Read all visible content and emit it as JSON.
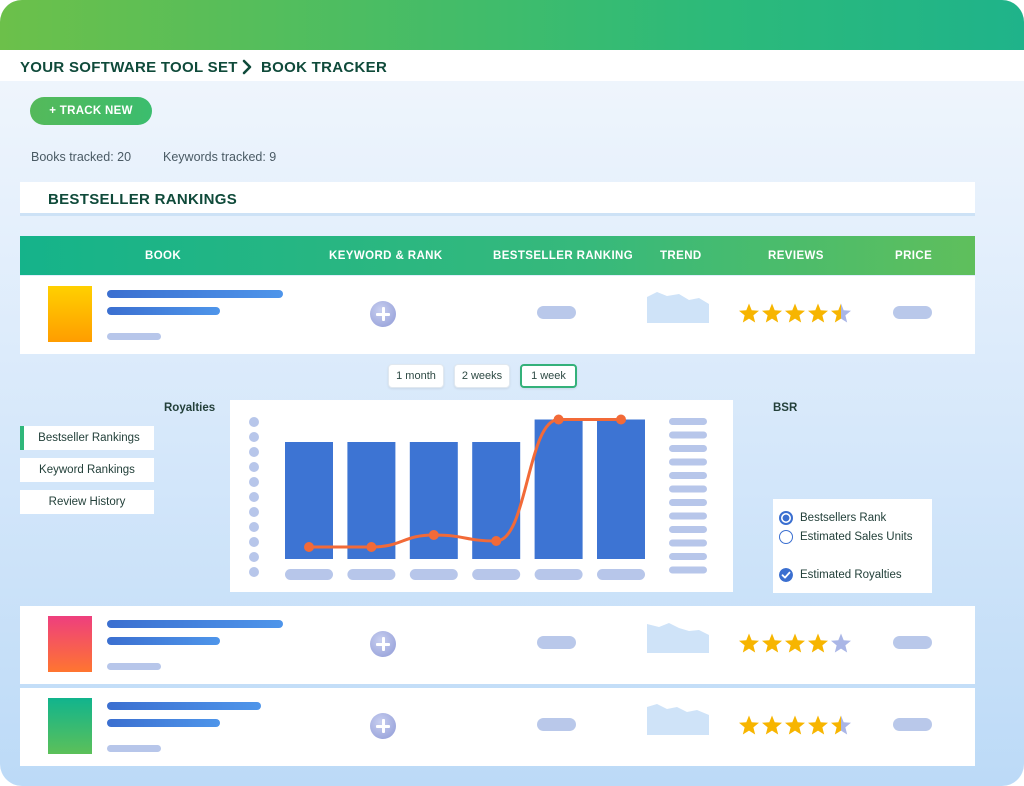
{
  "breadcrumb": {
    "root": "YOUR SOFTWARE TOOL SET",
    "current": "BOOK TRACKER"
  },
  "actions": {
    "track_new": "+ TRACK NEW"
  },
  "stats": {
    "books_tracked": "Books tracked: 20",
    "keywords_tracked": "Keywords tracked: 9"
  },
  "section": {
    "title": "BESTSELLER RANKINGS"
  },
  "table": {
    "headers": [
      "BOOK",
      "KEYWORD & RANK",
      "BESTSELLER RANKING",
      "TREND",
      "REVIEWS",
      "PRICE"
    ],
    "rows": [
      {
        "cover_colors": [
          "#ffd000",
          "#ff9d00"
        ],
        "rating": 4.5
      },
      {
        "cover_colors": [
          "#ee3f7e",
          "#ff7530"
        ],
        "rating": 4
      },
      {
        "cover_colors": [
          "#11b48d",
          "#5cc059"
        ],
        "rating": 4.5
      }
    ]
  },
  "timeframes": [
    {
      "label": "1 month",
      "active": false
    },
    {
      "label": "2 weeks",
      "active": false
    },
    {
      "label": "1 week",
      "active": true
    }
  ],
  "side_tabs": [
    {
      "label": "Bestseller Rankings",
      "active": true
    },
    {
      "label": "Keyword Rankings",
      "active": false
    },
    {
      "label": "Review History",
      "active": false
    }
  ],
  "chart": {
    "left_axis_title": "Royalties",
    "right_axis_title": "BSR",
    "legend": [
      {
        "label": "Bestsellers Rank",
        "state": "radio-selected"
      },
      {
        "label": "Estimated Sales Units",
        "state": "radio-empty"
      },
      {
        "label": "Estimated Royalties",
        "state": "check-selected"
      }
    ]
  },
  "chart_data": {
    "type": "bar",
    "title": "",
    "xlabel": "",
    "ylabel": "Royalties",
    "y2label": "BSR",
    "ylim": [
      0,
      1
    ],
    "categories": [
      "",
      "",
      "",
      "",
      "",
      ""
    ],
    "series": [
      {
        "type": "bar",
        "values": [
          0.78,
          0.78,
          0.78,
          0.78,
          0.93,
          0.93
        ]
      },
      {
        "type": "line",
        "values": [
          0.08,
          0.08,
          0.16,
          0.12,
          0.93,
          0.93
        ]
      }
    ],
    "grid": false,
    "legend_position": "right",
    "colors": {
      "bars": "#3d74d3",
      "line": "#f26a38"
    }
  },
  "colors": {
    "accent_green": "#2fb77a",
    "header_green": "#15b38a",
    "brand_dark": "#0f4a3a"
  }
}
